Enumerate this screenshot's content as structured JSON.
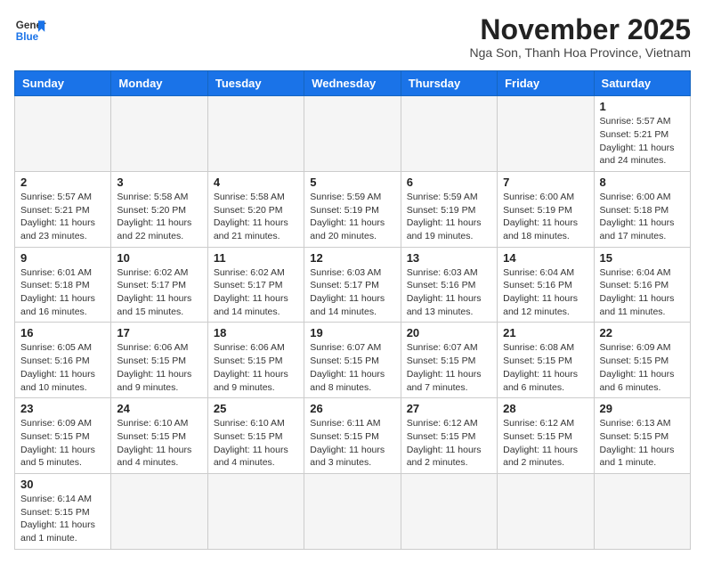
{
  "header": {
    "logo_line1": "General",
    "logo_line2": "Blue",
    "month_title": "November 2025",
    "subtitle": "Nga Son, Thanh Hoa Province, Vietnam"
  },
  "days_of_week": [
    "Sunday",
    "Monday",
    "Tuesday",
    "Wednesday",
    "Thursday",
    "Friday",
    "Saturday"
  ],
  "weeks": [
    [
      {
        "day": "",
        "info": ""
      },
      {
        "day": "",
        "info": ""
      },
      {
        "day": "",
        "info": ""
      },
      {
        "day": "",
        "info": ""
      },
      {
        "day": "",
        "info": ""
      },
      {
        "day": "",
        "info": ""
      },
      {
        "day": "1",
        "info": "Sunrise: 5:57 AM\nSunset: 5:21 PM\nDaylight: 11 hours\nand 24 minutes."
      }
    ],
    [
      {
        "day": "2",
        "info": "Sunrise: 5:57 AM\nSunset: 5:21 PM\nDaylight: 11 hours\nand 23 minutes."
      },
      {
        "day": "3",
        "info": "Sunrise: 5:58 AM\nSunset: 5:20 PM\nDaylight: 11 hours\nand 22 minutes."
      },
      {
        "day": "4",
        "info": "Sunrise: 5:58 AM\nSunset: 5:20 PM\nDaylight: 11 hours\nand 21 minutes."
      },
      {
        "day": "5",
        "info": "Sunrise: 5:59 AM\nSunset: 5:19 PM\nDaylight: 11 hours\nand 20 minutes."
      },
      {
        "day": "6",
        "info": "Sunrise: 5:59 AM\nSunset: 5:19 PM\nDaylight: 11 hours\nand 19 minutes."
      },
      {
        "day": "7",
        "info": "Sunrise: 6:00 AM\nSunset: 5:19 PM\nDaylight: 11 hours\nand 18 minutes."
      },
      {
        "day": "8",
        "info": "Sunrise: 6:00 AM\nSunset: 5:18 PM\nDaylight: 11 hours\nand 17 minutes."
      }
    ],
    [
      {
        "day": "9",
        "info": "Sunrise: 6:01 AM\nSunset: 5:18 PM\nDaylight: 11 hours\nand 16 minutes."
      },
      {
        "day": "10",
        "info": "Sunrise: 6:02 AM\nSunset: 5:17 PM\nDaylight: 11 hours\nand 15 minutes."
      },
      {
        "day": "11",
        "info": "Sunrise: 6:02 AM\nSunset: 5:17 PM\nDaylight: 11 hours\nand 14 minutes."
      },
      {
        "day": "12",
        "info": "Sunrise: 6:03 AM\nSunset: 5:17 PM\nDaylight: 11 hours\nand 14 minutes."
      },
      {
        "day": "13",
        "info": "Sunrise: 6:03 AM\nSunset: 5:16 PM\nDaylight: 11 hours\nand 13 minutes."
      },
      {
        "day": "14",
        "info": "Sunrise: 6:04 AM\nSunset: 5:16 PM\nDaylight: 11 hours\nand 12 minutes."
      },
      {
        "day": "15",
        "info": "Sunrise: 6:04 AM\nSunset: 5:16 PM\nDaylight: 11 hours\nand 11 minutes."
      }
    ],
    [
      {
        "day": "16",
        "info": "Sunrise: 6:05 AM\nSunset: 5:16 PM\nDaylight: 11 hours\nand 10 minutes."
      },
      {
        "day": "17",
        "info": "Sunrise: 6:06 AM\nSunset: 5:15 PM\nDaylight: 11 hours\nand 9 minutes."
      },
      {
        "day": "18",
        "info": "Sunrise: 6:06 AM\nSunset: 5:15 PM\nDaylight: 11 hours\nand 9 minutes."
      },
      {
        "day": "19",
        "info": "Sunrise: 6:07 AM\nSunset: 5:15 PM\nDaylight: 11 hours\nand 8 minutes."
      },
      {
        "day": "20",
        "info": "Sunrise: 6:07 AM\nSunset: 5:15 PM\nDaylight: 11 hours\nand 7 minutes."
      },
      {
        "day": "21",
        "info": "Sunrise: 6:08 AM\nSunset: 5:15 PM\nDaylight: 11 hours\nand 6 minutes."
      },
      {
        "day": "22",
        "info": "Sunrise: 6:09 AM\nSunset: 5:15 PM\nDaylight: 11 hours\nand 6 minutes."
      }
    ],
    [
      {
        "day": "23",
        "info": "Sunrise: 6:09 AM\nSunset: 5:15 PM\nDaylight: 11 hours\nand 5 minutes."
      },
      {
        "day": "24",
        "info": "Sunrise: 6:10 AM\nSunset: 5:15 PM\nDaylight: 11 hours\nand 4 minutes."
      },
      {
        "day": "25",
        "info": "Sunrise: 6:10 AM\nSunset: 5:15 PM\nDaylight: 11 hours\nand 4 minutes."
      },
      {
        "day": "26",
        "info": "Sunrise: 6:11 AM\nSunset: 5:15 PM\nDaylight: 11 hours\nand 3 minutes."
      },
      {
        "day": "27",
        "info": "Sunrise: 6:12 AM\nSunset: 5:15 PM\nDaylight: 11 hours\nand 2 minutes."
      },
      {
        "day": "28",
        "info": "Sunrise: 6:12 AM\nSunset: 5:15 PM\nDaylight: 11 hours\nand 2 minutes."
      },
      {
        "day": "29",
        "info": "Sunrise: 6:13 AM\nSunset: 5:15 PM\nDaylight: 11 hours\nand 1 minute."
      }
    ],
    [
      {
        "day": "30",
        "info": "Sunrise: 6:14 AM\nSunset: 5:15 PM\nDaylight: 11 hours\nand 1 minute."
      },
      {
        "day": "",
        "info": ""
      },
      {
        "day": "",
        "info": ""
      },
      {
        "day": "",
        "info": ""
      },
      {
        "day": "",
        "info": ""
      },
      {
        "day": "",
        "info": ""
      },
      {
        "day": "",
        "info": ""
      }
    ]
  ]
}
